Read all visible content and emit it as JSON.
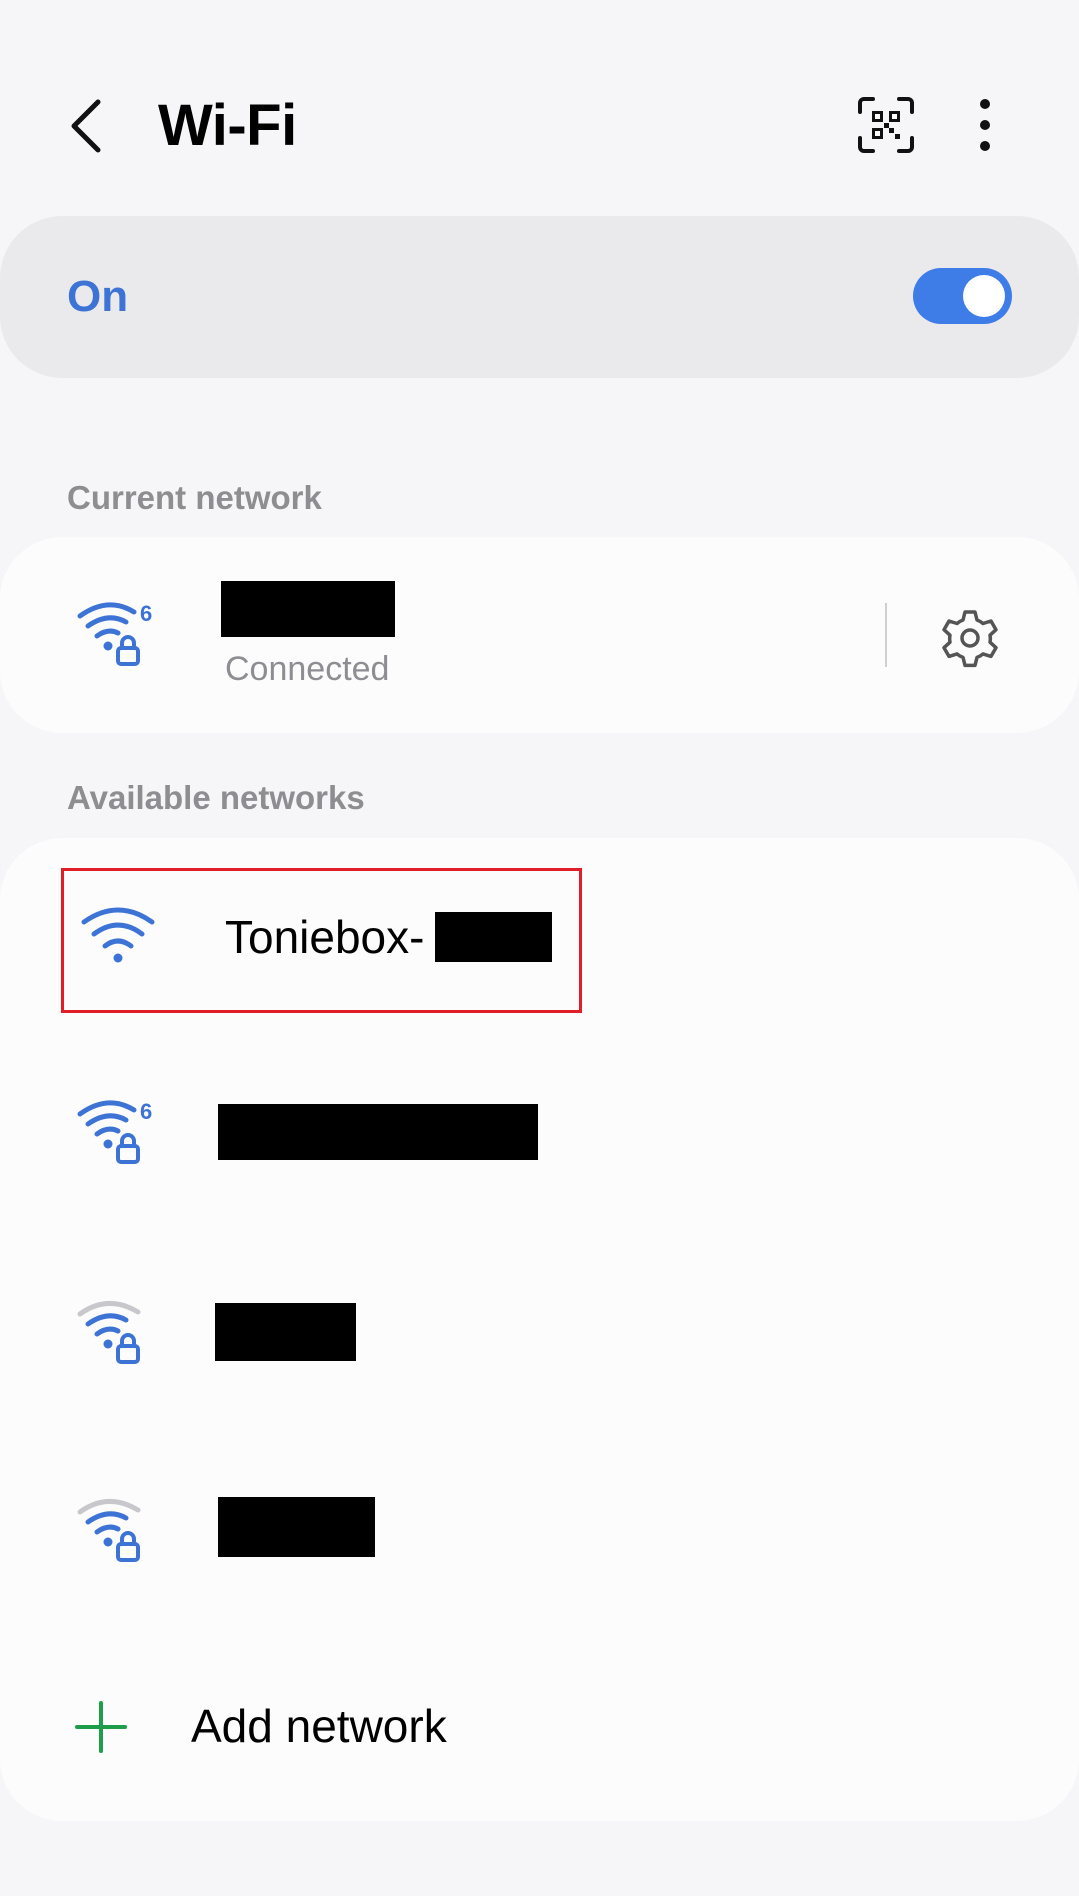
{
  "header": {
    "title": "Wi-Fi",
    "back_icon": "back-arrow-icon",
    "qr_icon": "qr-code-scan-icon",
    "more_icon": "more-vertical-icon"
  },
  "wifi_toggle": {
    "label": "On",
    "state": true,
    "accent_color": "#3e7de8"
  },
  "current_network": {
    "section_label": "Current network",
    "network": {
      "name_redacted": true,
      "status": "Connected",
      "icon": "wifi-6-secured-icon",
      "settings_icon": "gear-icon"
    }
  },
  "available_networks": {
    "section_label": "Available networks",
    "networks": [
      {
        "name": "Toniebox-",
        "name_suffix_redacted": true,
        "icon": "wifi-open-full-icon",
        "highlighted": true
      },
      {
        "name_redacted": true,
        "icon": "wifi-6-secured-icon"
      },
      {
        "name_redacted": true,
        "icon": "wifi-secured-weak-icon"
      },
      {
        "name_redacted": true,
        "icon": "wifi-secured-weak-icon"
      }
    ],
    "add_network": {
      "label": "Add network",
      "icon": "plus-icon"
    }
  },
  "colors": {
    "highlight_border": "#e01e27",
    "wifi_blue": "#3e73d6",
    "wifi_gray": "#c8c8cc",
    "add_green": "#1e9e4a"
  }
}
